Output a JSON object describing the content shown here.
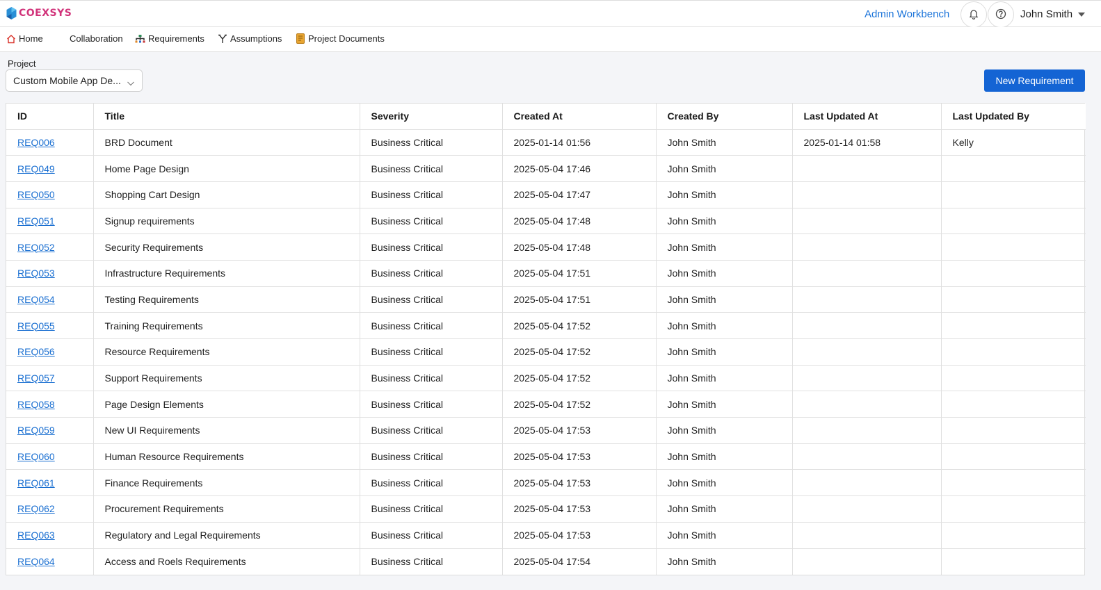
{
  "header": {
    "logo_text": "COEXSYS",
    "admin_link": "Admin Workbench",
    "user_name": "John Smith",
    "brand_color": "#d1337a"
  },
  "nav": {
    "items": [
      {
        "label": "Home",
        "icon": "home-icon"
      },
      {
        "label": "Collaboration",
        "icon": ""
      },
      {
        "label": "Requirements",
        "icon": "hierarchy-icon"
      },
      {
        "label": "Assumptions",
        "icon": "fork-icon"
      },
      {
        "label": "Project Documents",
        "icon": "document-icon"
      }
    ]
  },
  "project": {
    "label": "Project",
    "selected": "Custom Mobile App De..."
  },
  "actions": {
    "new_requirement": "New Requirement"
  },
  "table": {
    "columns": [
      "ID",
      "Title",
      "Severity",
      "Created At",
      "Created By",
      "Last Updated At",
      "Last Updated By"
    ],
    "rows": [
      {
        "id": "REQ006",
        "title": "BRD Document",
        "severity": "Business Critical",
        "created_at": "2025-01-14 01:56",
        "created_by": "John Smith",
        "updated_at": "2025-01-14 01:58",
        "updated_by": "Kelly"
      },
      {
        "id": "REQ049",
        "title": "Home Page Design",
        "severity": "Business Critical",
        "created_at": "2025-05-04 17:46",
        "created_by": "John Smith",
        "updated_at": "",
        "updated_by": ""
      },
      {
        "id": "REQ050",
        "title": "Shopping Cart Design",
        "severity": "Business Critical",
        "created_at": "2025-05-04 17:47",
        "created_by": "John Smith",
        "updated_at": "",
        "updated_by": ""
      },
      {
        "id": "REQ051",
        "title": "Signup requirements",
        "severity": "Business Critical",
        "created_at": "2025-05-04 17:48",
        "created_by": "John Smith",
        "updated_at": "",
        "updated_by": ""
      },
      {
        "id": "REQ052",
        "title": "Security Requirements",
        "severity": "Business Critical",
        "created_at": "2025-05-04 17:48",
        "created_by": "John Smith",
        "updated_at": "",
        "updated_by": ""
      },
      {
        "id": "REQ053",
        "title": "Infrastructure Requirements",
        "severity": "Business Critical",
        "created_at": "2025-05-04 17:51",
        "created_by": "John Smith",
        "updated_at": "",
        "updated_by": ""
      },
      {
        "id": "REQ054",
        "title": "Testing Requirements",
        "severity": "Business Critical",
        "created_at": "2025-05-04 17:51",
        "created_by": "John Smith",
        "updated_at": "",
        "updated_by": ""
      },
      {
        "id": "REQ055",
        "title": "Training Requirements",
        "severity": "Business Critical",
        "created_at": "2025-05-04 17:52",
        "created_by": "John Smith",
        "updated_at": "",
        "updated_by": ""
      },
      {
        "id": "REQ056",
        "title": "Resource Requirements",
        "severity": "Business Critical",
        "created_at": "2025-05-04 17:52",
        "created_by": "John Smith",
        "updated_at": "",
        "updated_by": ""
      },
      {
        "id": "REQ057",
        "title": "Support Requirements",
        "severity": "Business Critical",
        "created_at": "2025-05-04 17:52",
        "created_by": "John Smith",
        "updated_at": "",
        "updated_by": ""
      },
      {
        "id": "REQ058",
        "title": "Page Design Elements",
        "severity": "Business Critical",
        "created_at": "2025-05-04 17:52",
        "created_by": "John Smith",
        "updated_at": "",
        "updated_by": ""
      },
      {
        "id": "REQ059",
        "title": "New UI Requirements",
        "severity": "Business Critical",
        "created_at": "2025-05-04 17:53",
        "created_by": "John Smith",
        "updated_at": "",
        "updated_by": ""
      },
      {
        "id": "REQ060",
        "title": "Human Resource Requirements",
        "severity": "Business Critical",
        "created_at": "2025-05-04 17:53",
        "created_by": "John Smith",
        "updated_at": "",
        "updated_by": ""
      },
      {
        "id": "REQ061",
        "title": "Finance Requirements",
        "severity": "Business Critical",
        "created_at": "2025-05-04 17:53",
        "created_by": "John Smith",
        "updated_at": "",
        "updated_by": ""
      },
      {
        "id": "REQ062",
        "title": "Procurement Requirements",
        "severity": "Business Critical",
        "created_at": "2025-05-04 17:53",
        "created_by": "John Smith",
        "updated_at": "",
        "updated_by": ""
      },
      {
        "id": "REQ063",
        "title": "Regulatory and Legal Requirements",
        "severity": "Business Critical",
        "created_at": "2025-05-04 17:53",
        "created_by": "John Smith",
        "updated_at": "",
        "updated_by": ""
      },
      {
        "id": "REQ064",
        "title": "Access and Roels Requirements",
        "severity": "Business Critical",
        "created_at": "2025-05-04 17:54",
        "created_by": "John Smith",
        "updated_at": "",
        "updated_by": ""
      }
    ]
  }
}
